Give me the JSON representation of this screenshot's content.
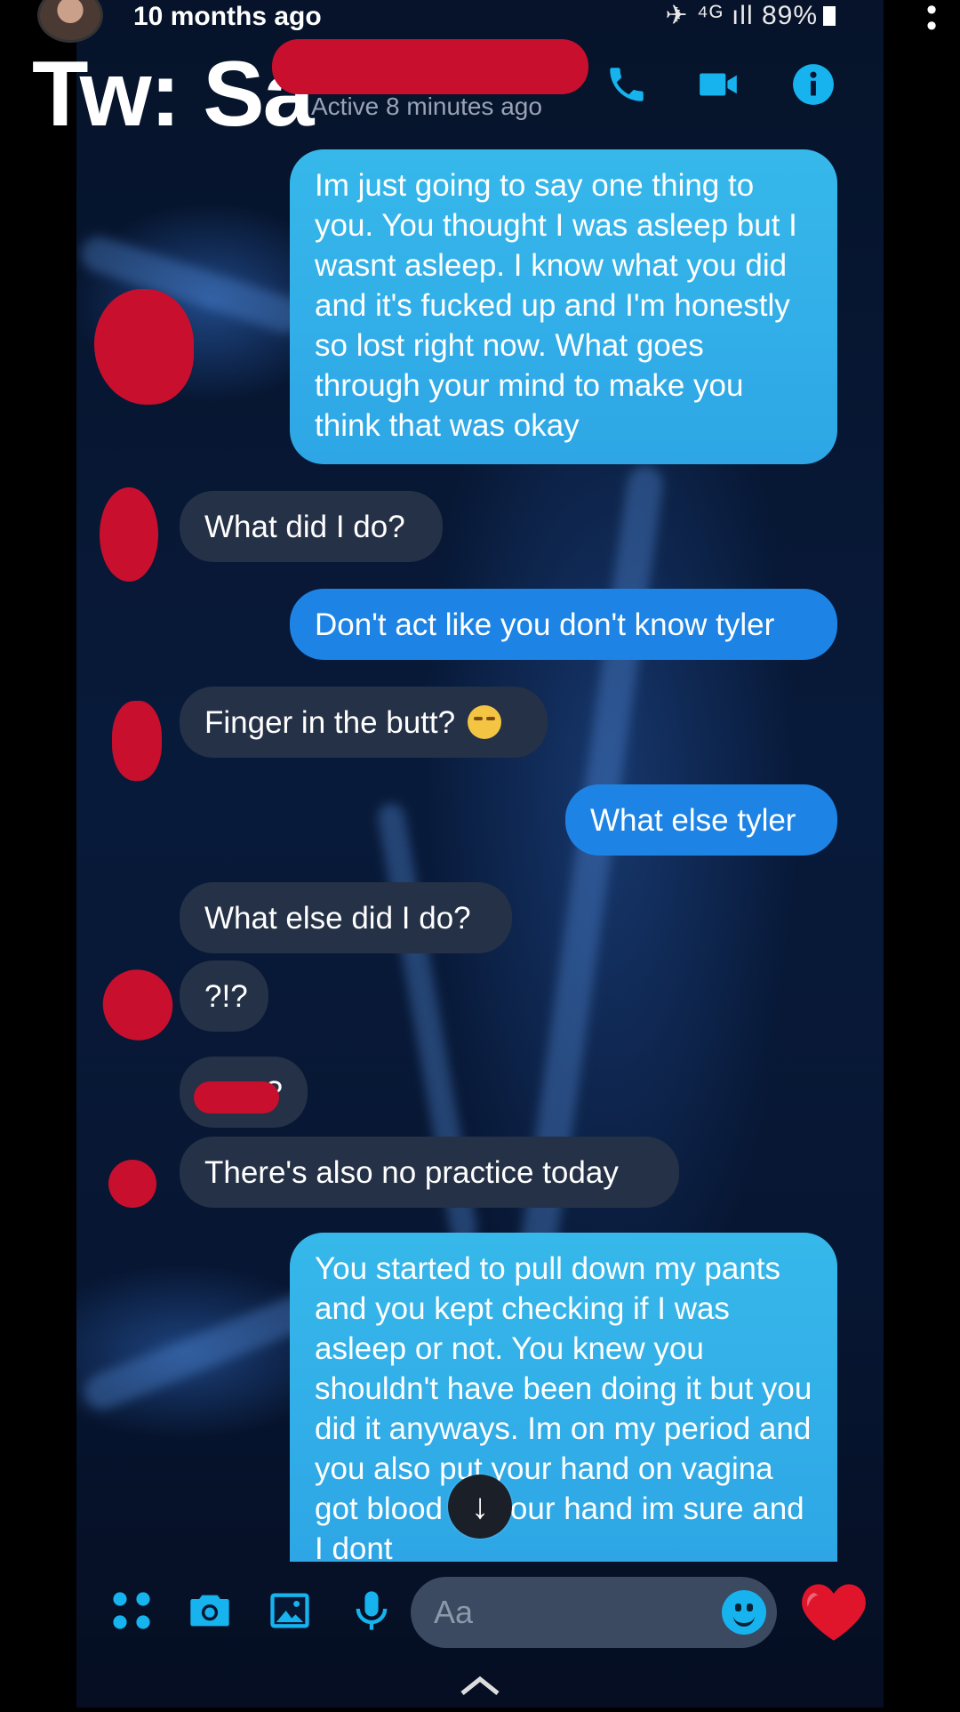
{
  "overlay": {
    "time_ago": "10 months ago",
    "caption": "Tw: Sa",
    "status": "89%"
  },
  "header": {
    "active_status": "Active 8 minutes ago",
    "icons": [
      "phone-icon",
      "video-camera-icon",
      "info-icon"
    ]
  },
  "messages": [
    {
      "side": "sent",
      "text": "Im just going to say one thing to you. You thought I was asleep but I wasnt asleep. I know what you did and it's fucked up and I'm honestly so lost right now. What goes through your mind to make you think that was okay"
    },
    {
      "side": "received",
      "text": "What did I do?"
    },
    {
      "side": "sent",
      "text": "Don't act like you don't know tyler"
    },
    {
      "side": "received",
      "text": "Finger in the butt?"
    },
    {
      "side": "sent",
      "text": "What else tyler"
    },
    {
      "side": "received",
      "text": "What else did I do?"
    },
    {
      "side": "received",
      "text": "?!?"
    },
    {
      "side": "received",
      "text": "?"
    },
    {
      "side": "received",
      "text": "There's also no practice today"
    },
    {
      "side": "sent",
      "text": "You started to pull down my pants and you kept checking if I was asleep or not. You knew you shouldn't have been doing it but you did it anyways. Im on my period and you also put your hand on vagina got blood on your hand im sure and I dont"
    }
  ],
  "composer": {
    "placeholder": "Aa",
    "icons": [
      "apps-grid-icon",
      "camera-icon",
      "gallery-icon",
      "microphone-icon",
      "emoji-icon",
      "heart-icon"
    ]
  },
  "colors": {
    "accent": "#16b3ef",
    "sent_bubble": "#36b8ea",
    "sent_bubble_dark": "#1d84e6",
    "received_bubble": "#253146",
    "redaction": "#c8102e"
  }
}
